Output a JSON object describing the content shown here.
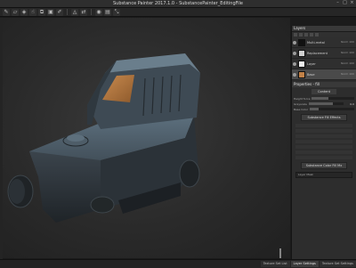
{
  "window": {
    "title": "Substance Painter 2017.1.0 - SubstancePainter_EditingFile"
  },
  "toolbar": {
    "icons": [
      "brush-icon",
      "eraser-icon",
      "projection-icon",
      "smudge-icon",
      "clone-icon",
      "fill-icon",
      "picker-icon",
      "polygon-fill-icon",
      "symmetry-icon",
      "camera-icon",
      "texture-icon",
      "scale-icon"
    ]
  },
  "layers_panel": {
    "header": "Layers",
    "items": [
      {
        "name": "Multi-metal",
        "blend": "Norm\n100"
      },
      {
        "name": "Replacement",
        "blend": "Norm\n100"
      },
      {
        "name": "Layer",
        "blend": "Norm\n100"
      },
      {
        "name": "Base",
        "blend": "Norm\n100",
        "selected": true
      }
    ]
  },
  "properties_panel": {
    "header": "Properties - fill",
    "tab": "Content",
    "rows": [
      {
        "label": "Height force",
        "value": ""
      },
      {
        "label": "Grayscale",
        "value": "0.0"
      },
      {
        "label": "Base Color",
        "value": ""
      }
    ],
    "button_fill": "Substance Fill Effects",
    "button_mask": "Substance Color Fill Mx",
    "select_value": "Layer Mask"
  },
  "bottom_tabs": [
    "Texture Set List",
    "Layer Settings",
    "Texture Set Settings"
  ],
  "colors": {
    "lens": "#b5743b",
    "body": "#2f353b",
    "accent": "#4a4a4a"
  }
}
